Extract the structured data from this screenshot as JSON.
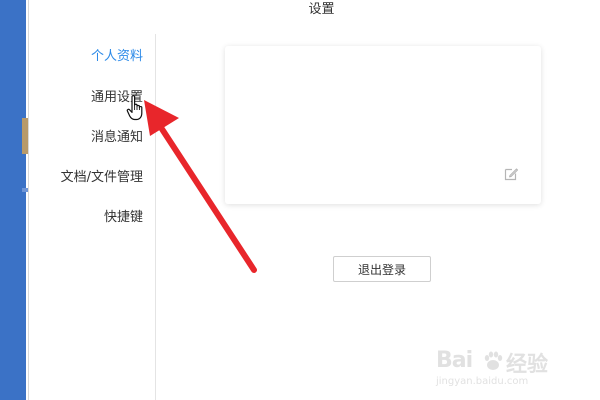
{
  "window": {
    "title": "设置"
  },
  "sidebar": {
    "items": [
      {
        "label": "个人资料",
        "active": true
      },
      {
        "label": "通用设置",
        "active": false
      },
      {
        "label": "消息通知",
        "active": false
      },
      {
        "label": "文档/文件管理",
        "active": false
      },
      {
        "label": "快捷键",
        "active": false
      }
    ]
  },
  "profile_card": {
    "edit_icon": "edit-icon"
  },
  "actions": {
    "logout_label": "退出登录"
  },
  "annotation": {
    "arrow_color": "#e8262b",
    "cursor_icon": "hand-pointer-icon"
  },
  "watermark": {
    "brand": "Bai",
    "name": "经验",
    "url": "jingyan.baidu.com"
  },
  "colors": {
    "accent": "#2c8ae8",
    "text": "#333333",
    "left_strip": "#3b72c6"
  }
}
